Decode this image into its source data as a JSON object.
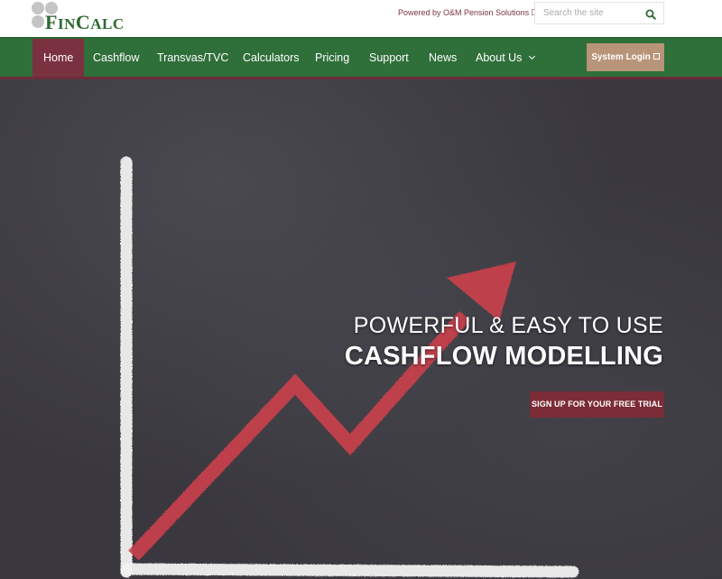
{
  "brand": {
    "logo_main": "F",
    "logo_small": "IN",
    "logo_main2": "C",
    "logo_small2": "ALC",
    "name": "FinCalc",
    "green": "#2f6f3a",
    "maroon": "#7a3140"
  },
  "header": {
    "powered_by": "Powered by O&M Pension Solutions",
    "powered_by_icon": "external-link-icon",
    "search": {
      "placeholder": "Search the site",
      "value": "",
      "icon": "search-icon"
    }
  },
  "nav": {
    "items": [
      {
        "label": "Home",
        "active": true
      },
      {
        "label": "Cashflow",
        "active": false
      },
      {
        "label": "Transvas/TVC",
        "active": false
      },
      {
        "label": "Calculators",
        "active": false
      },
      {
        "label": "Pricing",
        "active": false
      },
      {
        "label": "Support",
        "active": false
      },
      {
        "label": "News",
        "active": false
      },
      {
        "label": "About Us",
        "active": false,
        "has_dropdown": true
      }
    ],
    "login_label": "System Login",
    "login_icon": "external-link-icon"
  },
  "hero": {
    "line1": "POWERFUL & EASY TO USE",
    "line2": "CASHFLOW MODELLING",
    "cta_label": "SIGN UP FOR YOUR FREE TRIAL",
    "background": "chalkboard-growth-chart-image"
  }
}
